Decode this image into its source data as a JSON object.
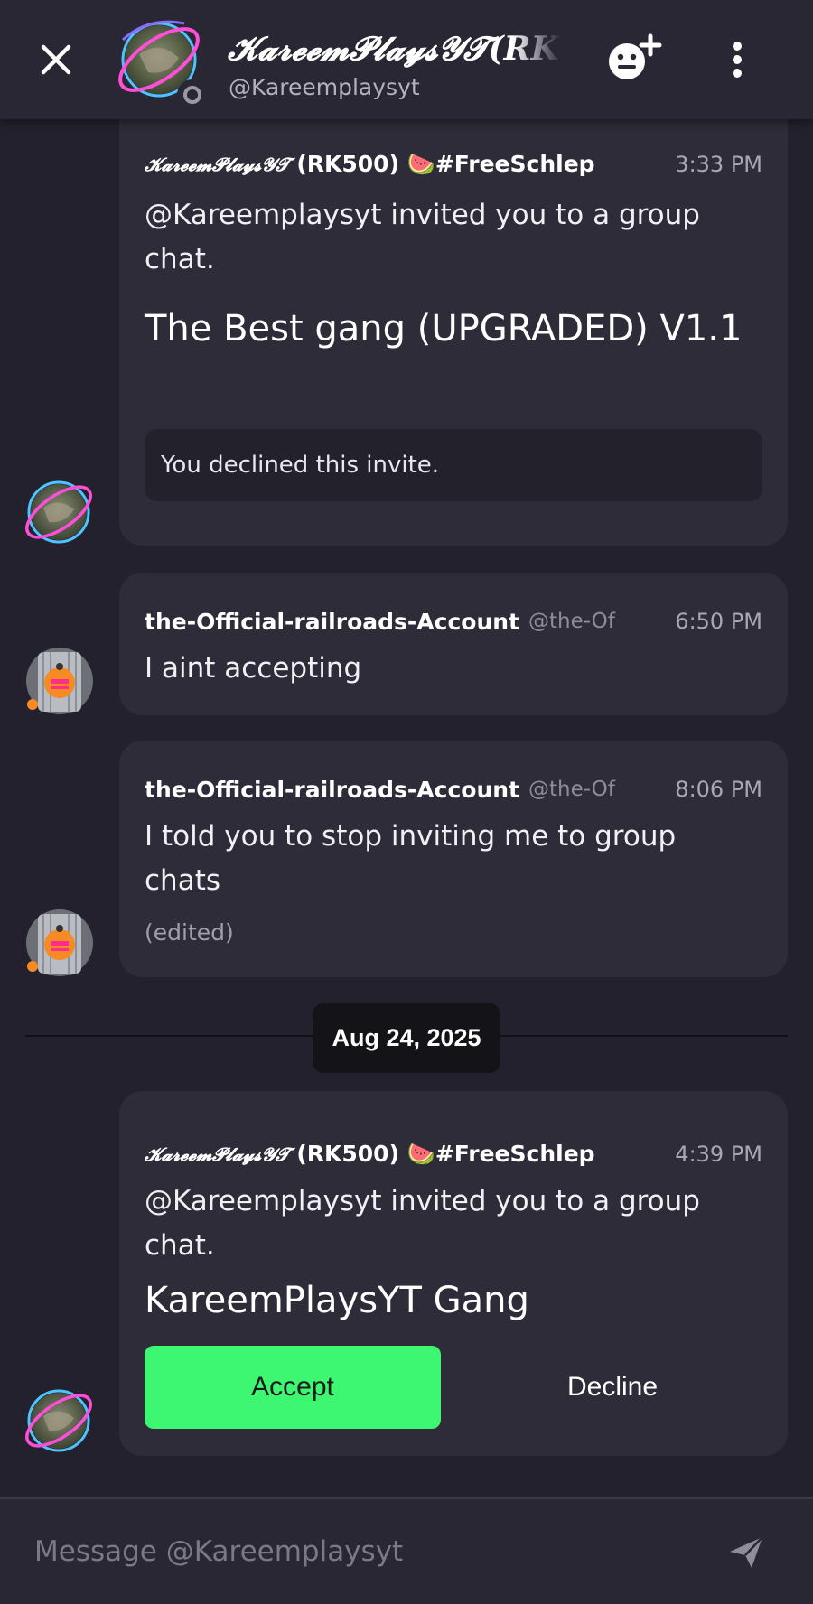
{
  "header": {
    "name": "𝓚𝓪𝓻𝓮𝓮𝓶𝓟𝓵𝓪𝔂𝓼𝓨𝓣(RK",
    "handle": "@Kareemplaysyt"
  },
  "messages": [
    {
      "author_script": "𝓚𝓪𝓻𝓮𝓮𝓶𝓟𝓵𝓪𝔂𝓼𝓨𝓣",
      "author_rest": "(RK500) 🍉#FreeSchlep",
      "time": "3:33 PM",
      "text": "@Kareemplaysyt invited you to a group chat.",
      "group_name": "The Best gang (UPGRADED) V1.1",
      "status": "You declined this invite."
    },
    {
      "author": "the-Official-railroads-Account",
      "handle": "@the-Of",
      "time": "6:50 PM",
      "text": "I aint accepting"
    },
    {
      "author": "the-Official-railroads-Account",
      "handle": "@the-Of",
      "time": "8:06 PM",
      "text": "I told you to stop inviting me to group chats",
      "edited": "(edited)"
    },
    {
      "author_script": "𝓚𝓪𝓻𝓮𝓮𝓶𝓟𝓵𝓪𝔂𝓼𝓨𝓣",
      "author_rest": "(RK500) 🍉#FreeSchlep",
      "time": "4:39 PM",
      "text": "@Kareemplaysyt invited you to a group chat.",
      "group_name": "KareemPlaysYT Gang",
      "accept_label": "Accept",
      "decline_label": "Decline"
    }
  ],
  "date_divider": "Aug 24, 2025",
  "composer": {
    "placeholder": "Message @Kareemplaysyt"
  },
  "colors": {
    "background": "#23212d",
    "card": "#2e2c38",
    "accept": "#3df672"
  }
}
